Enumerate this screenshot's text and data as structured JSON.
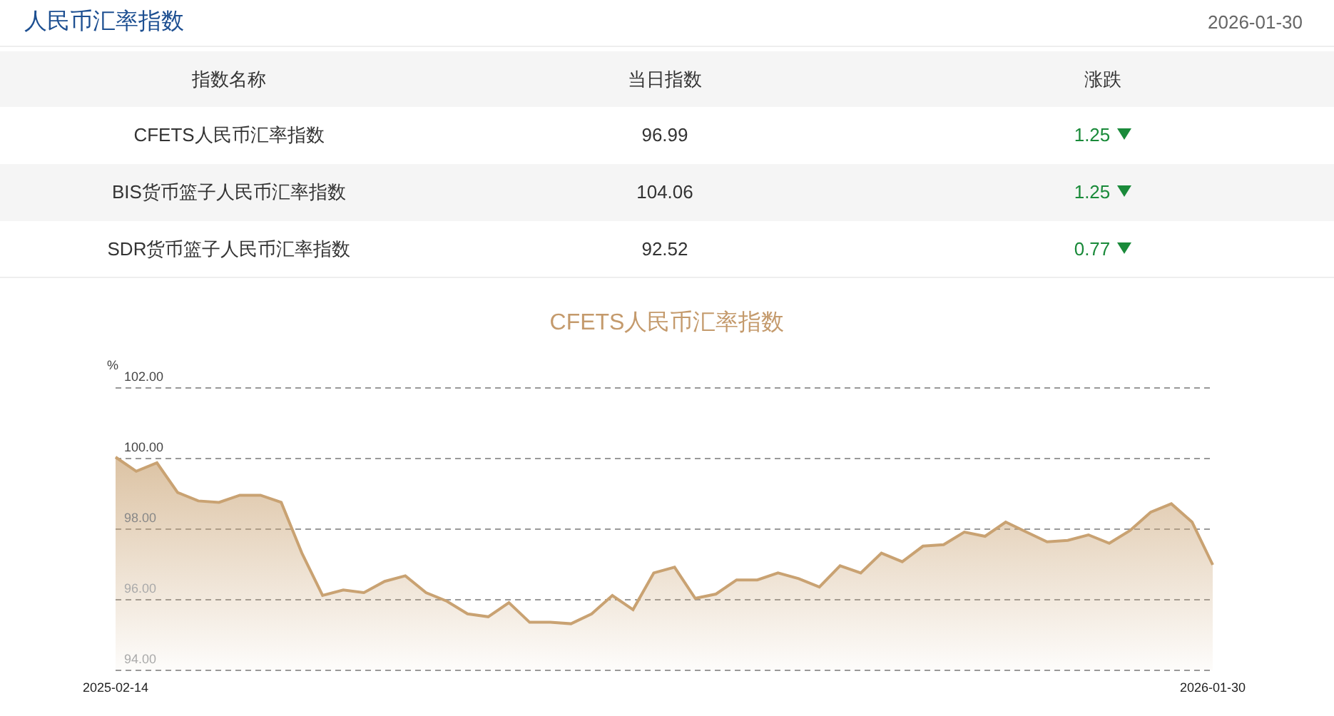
{
  "header": {
    "title": "人民币汇率指数",
    "date": "2026-01-30"
  },
  "table": {
    "columns": [
      "指数名称",
      "当日指数",
      "涨跌"
    ],
    "rows": [
      {
        "name": "CFETS人民币汇率指数",
        "value": "96.99",
        "change": "1.25",
        "kind": "down"
      },
      {
        "name": "BIS货币篮子人民币汇率指数",
        "value": "104.06",
        "change": "1.25",
        "kind": "down"
      },
      {
        "name": "SDR货币篮子人民币汇率指数",
        "value": "92.52",
        "change": "0.77",
        "kind": "down"
      }
    ]
  },
  "chart": {
    "chart_data": {
      "type": "area",
      "title": "CFETS人民币汇率指数",
      "ylabel": "%",
      "grid": true,
      "categories": [
        "2025-02-14",
        null,
        null,
        null,
        null,
        null,
        null,
        null,
        null,
        null,
        null,
        null,
        null,
        null,
        null,
        null,
        null,
        null,
        null,
        null,
        null,
        null,
        null,
        null,
        null,
        null,
        null,
        null,
        null,
        null,
        null,
        null,
        null,
        null,
        null,
        null,
        null,
        null,
        null,
        null,
        null,
        null,
        null,
        null,
        null,
        null,
        null,
        null,
        null,
        null,
        null,
        null,
        null,
        "2026-01-30"
      ],
      "series": [
        {
          "color": "#c9a272",
          "values": [
            100.04,
            99.64,
            99.88,
            99.04,
            98.8,
            98.76,
            98.96,
            98.96,
            98.76,
            97.32,
            96.12,
            96.28,
            96.2,
            96.52,
            96.68,
            96.2,
            95.96,
            95.6,
            95.52,
            95.92,
            95.36,
            95.36,
            95.32,
            95.6,
            96.12,
            95.72,
            96.76,
            96.92,
            96.04,
            96.16,
            96.56,
            96.56,
            96.76,
            96.6,
            96.36,
            96.96,
            96.76,
            97.32,
            97.08,
            97.52,
            97.56,
            97.92,
            97.8,
            98.2,
            97.92,
            97.64,
            97.68,
            97.84,
            97.6,
            97.96,
            98.48,
            98.72,
            98.2,
            96.99
          ]
        }
      ],
      "ylim": [
        94,
        102
      ],
      "yticks": [
        {
          "value": 94,
          "label": "94.00"
        },
        {
          "value": 96,
          "label": "96.00"
        },
        {
          "value": 98,
          "label": "98.00"
        },
        {
          "value": 100,
          "label": "100.00"
        },
        {
          "value": 102,
          "label": "102.00"
        }
      ]
    }
  }
}
